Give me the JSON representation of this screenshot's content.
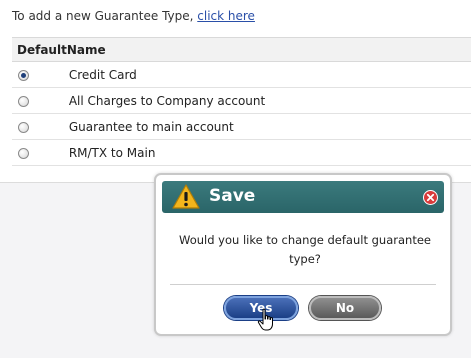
{
  "intro": {
    "text": "To add a new Guarantee Type, ",
    "link_label": "click here"
  },
  "table": {
    "headers": {
      "default": "Default",
      "name": "Name"
    },
    "rows": [
      {
        "name": "Credit Card",
        "selected": true
      },
      {
        "name": "All Charges to Company account",
        "selected": false
      },
      {
        "name": "Guarantee to main account",
        "selected": false
      },
      {
        "name": "RM/TX to Main",
        "selected": false
      }
    ]
  },
  "dialog": {
    "title": "Save",
    "message": "Would you like to change default guarantee type?",
    "yes_label": "Yes",
    "no_label": "No",
    "icons": {
      "title": "warning-icon",
      "close": "close-icon",
      "pointer": "hand-cursor-icon"
    }
  },
  "colors": {
    "title_bar": "#2f6f72",
    "yes_button": "#1f3f86",
    "no_button": "#6b6b6b",
    "link": "#2a4fa8",
    "close_icon": "#d93b3b",
    "warning_icon": "#f2b51c"
  }
}
